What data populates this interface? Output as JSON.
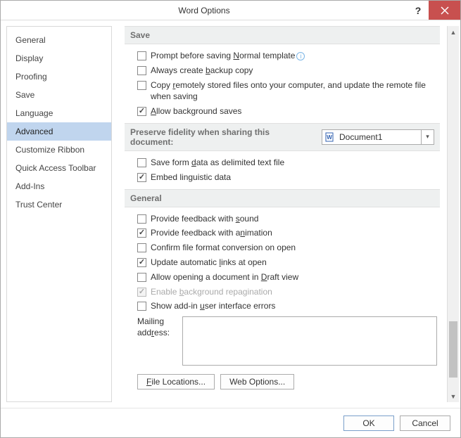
{
  "title": "Word Options",
  "sidebar": {
    "items": [
      {
        "label": "General"
      },
      {
        "label": "Display"
      },
      {
        "label": "Proofing"
      },
      {
        "label": "Save"
      },
      {
        "label": "Language"
      },
      {
        "label": "Advanced"
      },
      {
        "label": "Customize Ribbon"
      },
      {
        "label": "Quick Access Toolbar"
      },
      {
        "label": "Add-Ins"
      },
      {
        "label": "Trust Center"
      }
    ],
    "selected": "Advanced"
  },
  "sections": {
    "save": {
      "header": "Save",
      "opts": {
        "prompt": {
          "label_html": "Prompt before saving <u>N</u>ormal template",
          "checked": false,
          "info": true
        },
        "backup": {
          "label_html": "Always create <u>b</u>ackup copy",
          "checked": false
        },
        "remote": {
          "label_html": "Copy <u>r</u>emotely stored files onto your computer, and update the remote file when saving",
          "checked": false
        },
        "bgsave": {
          "label_html": "<u>A</u>llow background saves",
          "checked": true
        }
      }
    },
    "preserve": {
      "header": "Preserve fidelity when sharing this document:",
      "doc_selected": "Document1",
      "opts": {
        "formdata": {
          "label_html": "Save form <u>d</u>ata as delimited text file",
          "checked": false
        },
        "linguist": {
          "label_html": "Embed linguistic data",
          "checked": true
        }
      }
    },
    "general": {
      "header": "General",
      "opts": {
        "sound": {
          "label_html": "Provide feedback with <u>s</u>ound",
          "checked": false
        },
        "anim": {
          "label_html": "Provide feedback with a<u>n</u>imation",
          "checked": true
        },
        "confirm": {
          "label_html": "Confirm file format conversion on open",
          "checked": false
        },
        "autolink": {
          "label_html": "Update automatic <u>l</u>inks at open",
          "checked": true
        },
        "draft": {
          "label_html": "Allow opening a document in <u>D</u>raft view",
          "checked": false
        },
        "repag": {
          "label_html": "Enable <u>b</u>ackground repagination",
          "checked": true,
          "disabled": true
        },
        "addinerr": {
          "label_html": "Show add-in <u>u</u>ser interface errors",
          "checked": false
        }
      },
      "mailing_label_html": "Mailing<br>add<u>r</u>ess:",
      "mailing_value": "",
      "buttons": {
        "file_locations": "File Locations...",
        "web_options": "Web Options..."
      }
    }
  },
  "footer": {
    "ok": "OK",
    "cancel": "Cancel"
  }
}
